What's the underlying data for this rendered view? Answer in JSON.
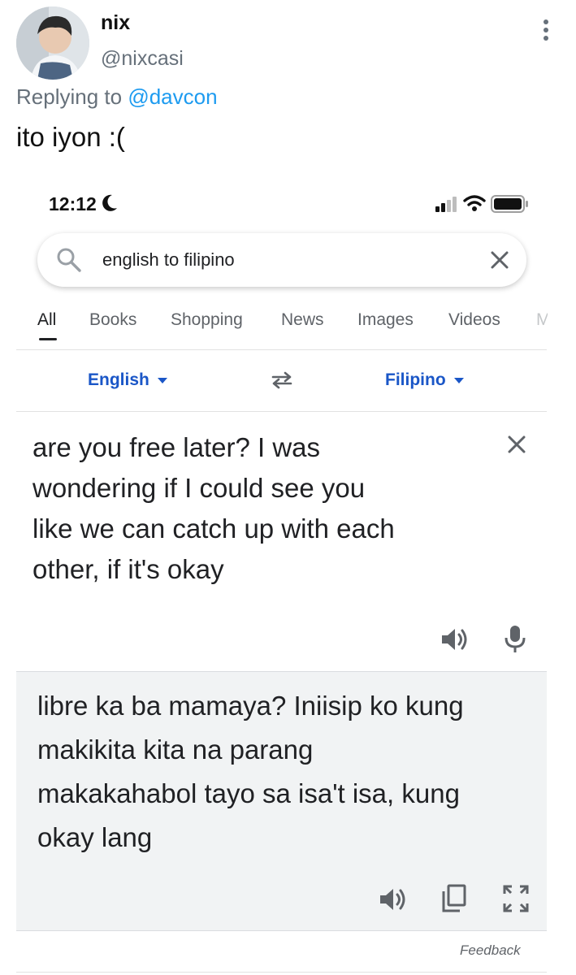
{
  "tweet": {
    "display_name": "nix",
    "handle": "@nixcasi",
    "reply_prefix": "Replying to",
    "reply_to": "@davcon",
    "text": "ito iyon :("
  },
  "status_bar": {
    "time": "12:12"
  },
  "search": {
    "query": "english to filipino"
  },
  "tabs": [
    {
      "label": "All",
      "active": true
    },
    {
      "label": "Books"
    },
    {
      "label": "Shopping"
    },
    {
      "label": "News"
    },
    {
      "label": "Images"
    },
    {
      "label": "Videos"
    },
    {
      "label": "M"
    }
  ],
  "translator": {
    "source_lang": "English",
    "target_lang": "Filipino",
    "source_text": "are you free later? I was wondering if I could see you like we can catch up with each other, if it's okay",
    "source_lines": [
      "are you free later? I was",
      "wondering if I could see you",
      "like we can catch up with each",
      "other, if it's okay"
    ],
    "result_lines": [
      "libre ka ba mamaya? Iniisip ko kung",
      "makikita kita na parang",
      "makakahabol tayo sa isa't isa, kung",
      "okay lang"
    ],
    "feedback_label": "Feedback"
  },
  "icons": {
    "more": "more-vertical-icon",
    "moon": "moon-icon",
    "signal": "cellular-signal-icon",
    "wifi": "wifi-icon",
    "battery": "battery-icon",
    "search": "search-icon",
    "clear": "close-icon",
    "swap": "swap-icon",
    "speaker": "speaker-icon",
    "mic": "microphone-icon",
    "copy": "copy-icon",
    "fullscreen": "fullscreen-icon"
  },
  "colors": {
    "mention": "#1d9bf0",
    "lang_link": "#1a56c7",
    "muted": "#66707a",
    "result_bg": "#f1f3f4"
  }
}
